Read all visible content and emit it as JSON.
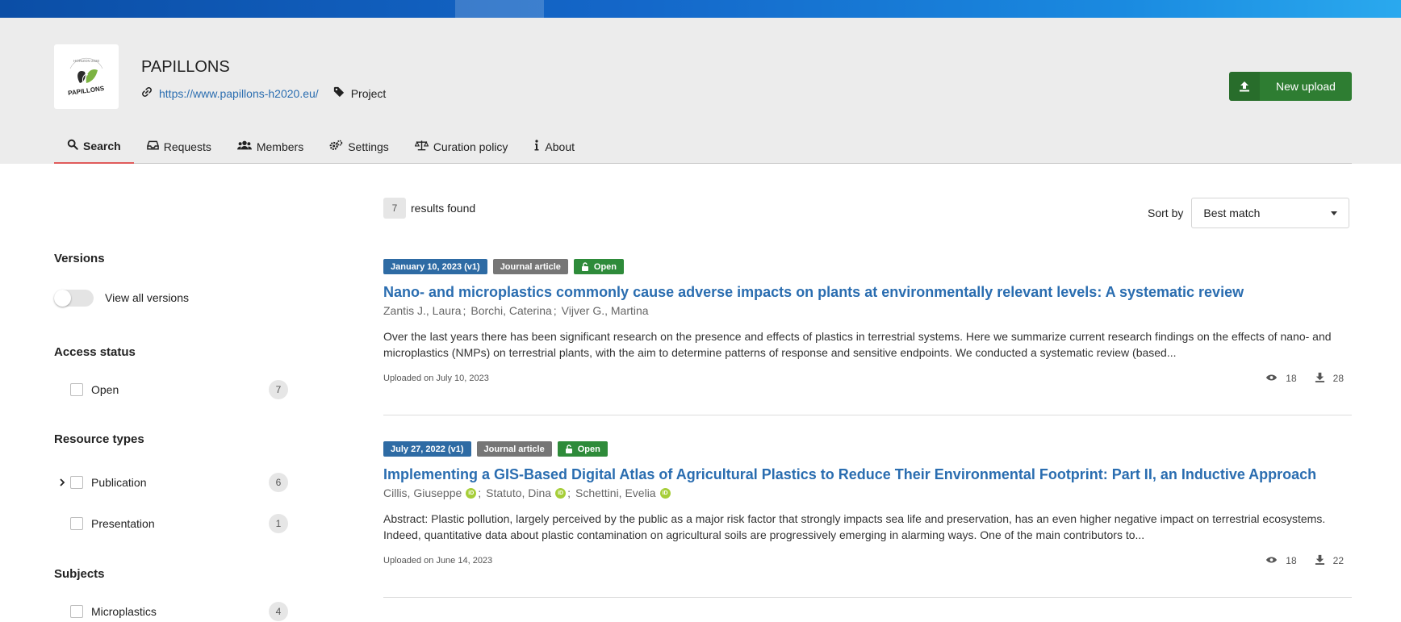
{
  "community": {
    "title": "PAPILLONS",
    "url": "https://www.papillons-h2020.eu/",
    "type": "Project",
    "logo_text": "PAPILLONS",
    "logo_ring_text": "HORIZON 2020"
  },
  "header": {
    "upload_label": "New upload"
  },
  "tabs": [
    {
      "label": "Search",
      "icon": "search-icon"
    },
    {
      "label": "Requests",
      "icon": "inbox-icon"
    },
    {
      "label": "Members",
      "icon": "users-icon"
    },
    {
      "label": "Settings",
      "icon": "cogs-icon"
    },
    {
      "label": "Curation policy",
      "icon": "balance-scale-icon"
    },
    {
      "label": "About",
      "icon": "info-icon"
    }
  ],
  "results": {
    "count": "7",
    "label": "results found"
  },
  "sort": {
    "label": "Sort by",
    "selected": "Best match"
  },
  "facets": {
    "versions": {
      "title": "Versions",
      "toggle_label": "View all versions"
    },
    "access": {
      "title": "Access status",
      "items": [
        {
          "label": "Open",
          "count": "7"
        }
      ]
    },
    "resource_types": {
      "title": "Resource types",
      "items": [
        {
          "label": "Publication",
          "count": "6"
        },
        {
          "label": "Presentation",
          "count": "1"
        }
      ]
    },
    "subjects": {
      "title": "Subjects",
      "items": [
        {
          "label": "Microplastics",
          "count": "4"
        }
      ]
    }
  },
  "records": [
    {
      "date": "January 10, 2023 (v1)",
      "resource_type": "Journal article",
      "access": "Open",
      "title": "Nano- and microplastics commonly cause adverse impacts on plants at environmentally relevant levels: A systematic review",
      "authors": [
        "Zantis J., Laura",
        "Borchi, Caterina",
        "Vijver G., Martina"
      ],
      "description": "Over the last years there has been significant research on the presence and effects of plastics in terrestrial systems. Here we summarize current research findings on the effects of nano- and microplastics (NMPs) on terrestrial plants, with the aim to determine patterns of response and sensitive endpoints. We conducted a systematic review (based...",
      "uploaded": "Uploaded on July 10, 2023",
      "views": "18",
      "downloads": "28"
    },
    {
      "date": "July 27, 2022 (v1)",
      "resource_type": "Journal article",
      "access": "Open",
      "title": "Implementing a GIS-Based Digital Atlas of Agricultural Plastics to Reduce Their Environmental Footprint: Part II, an Inductive Approach",
      "authors": [
        "Cillis, Giuseppe",
        "Statuto, Dina",
        "Schettini, Evelia"
      ],
      "orcid_label": "iD",
      "description": "Abstract: Plastic pollution, largely perceived by the public as a major risk factor that strongly impacts sea life and preservation, has an even higher negative impact on terrestrial ecosystems. Indeed, quantitative data about plastic contamination on agricultural soils are progressively emerging in alarming ways. One of the main contributors to...",
      "uploaded": "Uploaded on June 14, 2023",
      "views": "18",
      "downloads": "22"
    }
  ],
  "colors": {
    "accent_blue": "#2a6db0",
    "upload_green": "#2e7d32",
    "open_green": "#2e8b3a",
    "active_tab_underline": "#e05b5b"
  }
}
